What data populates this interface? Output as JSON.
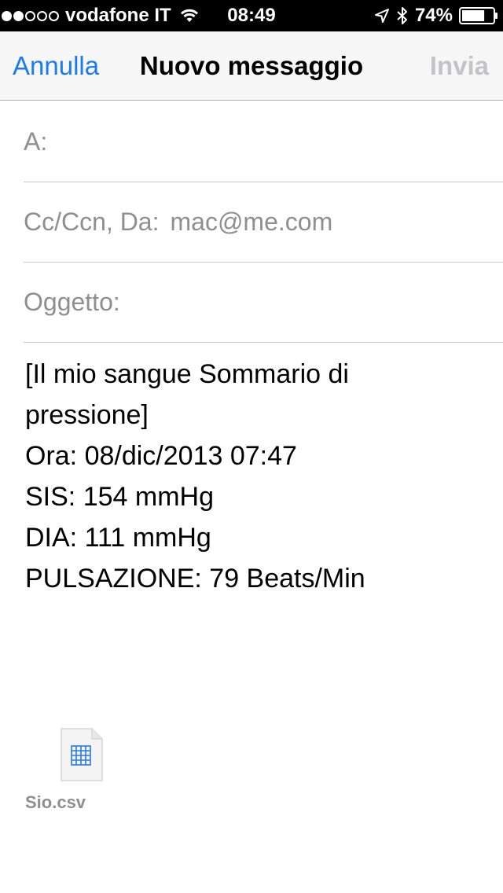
{
  "status_bar": {
    "carrier": "vodafone IT",
    "time": "08:49",
    "battery": "74%",
    "signal_strength": 2,
    "signal_max": 5,
    "battery_level": 0.74
  },
  "nav": {
    "cancel_label": "Annulla",
    "title": "Nuovo messaggio",
    "send_label": "Invia"
  },
  "fields": {
    "to_label": "A:",
    "cc_label": "Cc/Ccn, Da:",
    "from_value": "mac@me.com",
    "subject_label": "Oggetto:"
  },
  "body": {
    "lines": [
      "[Il mio sangue Sommario di",
      "pressione]",
      "Ora: 08/dic/2013 07:47",
      "SIS: 154 mmHg",
      "DIA: 111 mmHg",
      "PULSAZIONE: 79 Beats/Min"
    ]
  },
  "attachment": {
    "file_name": "Sio.csv",
    "icon": "spreadsheet-file-icon"
  },
  "colors": {
    "accent": "#1a7cf5",
    "disabled": "#c4c4c6",
    "label_gray": "#8e8e93"
  }
}
